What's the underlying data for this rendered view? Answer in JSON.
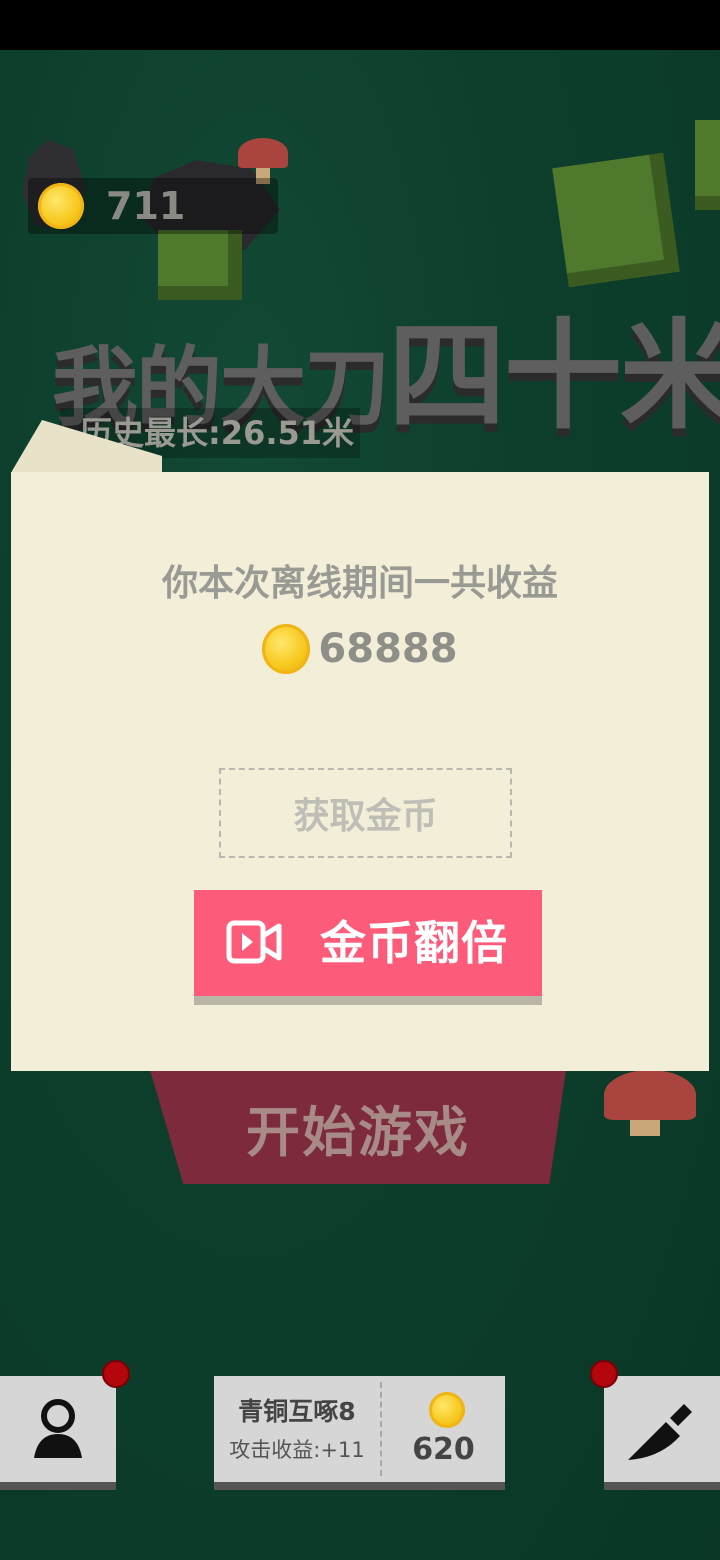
{
  "hud": {
    "coins": "711"
  },
  "game": {
    "title_part1": "我的大刀",
    "title_part2": "四十米",
    "best_record": "历史最长:26.51米",
    "start_label": "开始游戏"
  },
  "offline_dialog": {
    "message": "你本次离线期间一共收益",
    "reward": "68888",
    "collect_label": "获取金币",
    "double_label": "金币翻倍"
  },
  "bottom_bar": {
    "weapon_name": "青铜互啄8",
    "attack_income": "攻击收益:+11",
    "upgrade_cost": "620"
  },
  "colors": {
    "background": "#0b3b28",
    "modal": "#f2eed7",
    "double_button": "#fc5b7a",
    "start_banner": "#7c2a3c",
    "badge": "#b3070d",
    "coin": "#f7c81e"
  },
  "icons": {
    "coin": "coin-icon",
    "video": "video-camera-icon",
    "profile": "user-icon",
    "knife": "knife-icon",
    "notification": "red-dot-icon"
  }
}
